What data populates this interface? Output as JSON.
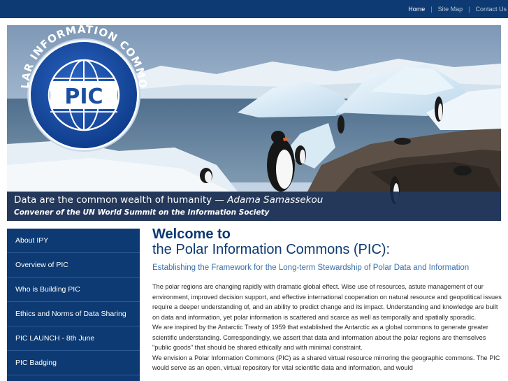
{
  "topnav": {
    "items": [
      "Home",
      "Site Map",
      "Contact Us"
    ],
    "separator": "|"
  },
  "banner": {
    "logo_ring_text": "POLAR INFORMATION COMMONS",
    "logo_center": "PIC",
    "quote_text": "Data are the common wealth of humanity —",
    "quote_author": "Adama Samassekou",
    "convener": "Convener of the UN World Summit on the Information Society"
  },
  "sidebar": {
    "items": [
      "About IPY",
      "Overview of PIC",
      "Who is Building PIC",
      "Ethics and Norms of Data Sharing",
      "PIC LAUNCH - 8th June",
      "PIC Badging"
    ]
  },
  "main": {
    "title_line1": "Welcome to",
    "title_line2": "the Polar Information Commons (PIC):",
    "subtitle": "Establishing the Framework for the Long-term Stewardship of Polar Data and Information",
    "paragraphs": [
      "The polar regions are changing rapidly with dramatic global effect. Wise use of resources, astute management of our environment, improved decision support, and effective international cooperation on natural resource and geopolitical issues require a deeper understanding of, and an ability to predict change and its impact. Understanding and knowledge are built on data and information, yet polar information is scattered and scarce as well as temporally and spatially sporadic.",
      "We are inspired by the Antarctic Treaty of 1959 that established the Antarctic as a global commons to generate greater scientific understanding. Correspondingly, we assert that data and information about the polar regions are themselves \"public goods\" that should be shared ethically and with minimal constraint.",
      "We envision a Polar Information Commons (PIC) as a shared virtual resource mirroring the geographic commons. The PIC would serve as an open, virtual repository for vital scientific data and information, and would"
    ]
  },
  "colors": {
    "navy": "#0d3a72",
    "title_blue": "#0d3a72",
    "subtitle_blue": "#3a6fa8",
    "logo_blue": "#1a4fa0"
  }
}
